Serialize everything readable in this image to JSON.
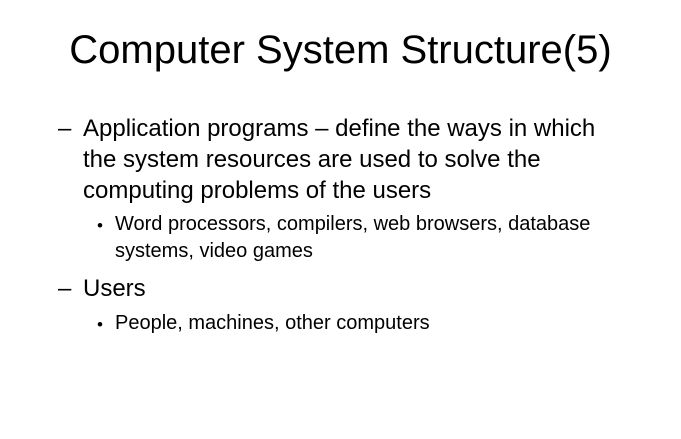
{
  "slide": {
    "title": "Computer System Structure(5)",
    "bullets": [
      {
        "marker": "–",
        "lines": [
          "Application programs – define the ways in which",
          "the system resources are used to solve the",
          "computing problems of the users"
        ]
      },
      {
        "marker": "•",
        "lines": [
          "Word processors, compilers, web browsers, database",
          "systems, video games"
        ]
      },
      {
        "marker": "–",
        "lines": [
          "Users"
        ]
      },
      {
        "marker": "•",
        "lines": [
          "People, machines, other computers"
        ]
      }
    ]
  }
}
